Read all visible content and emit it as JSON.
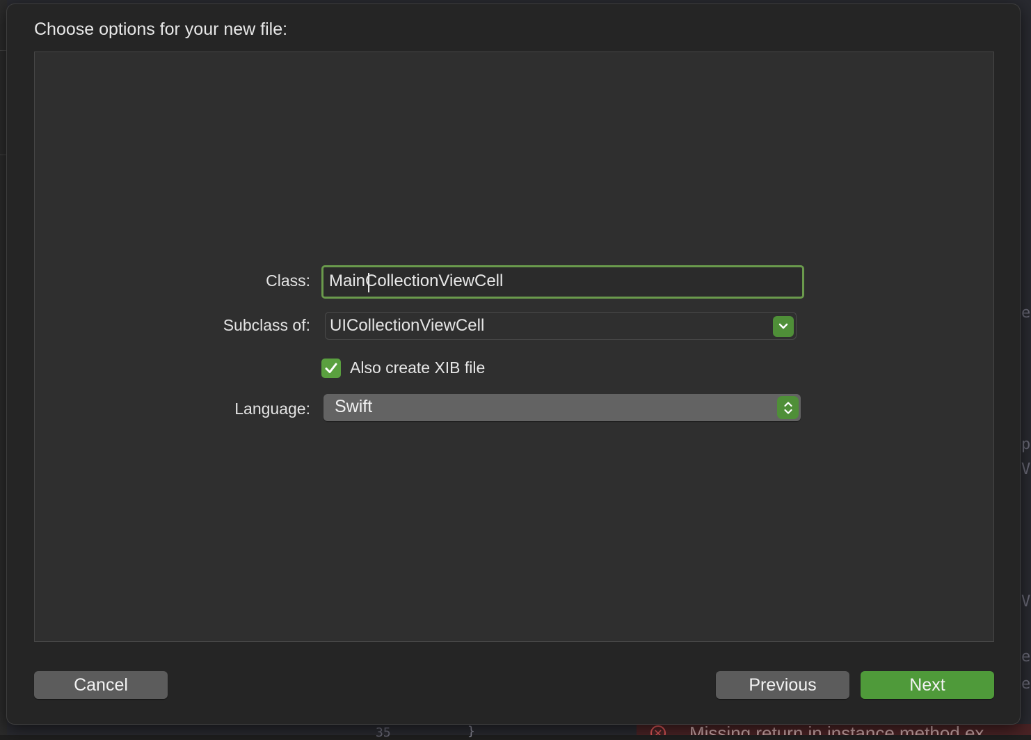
{
  "dialog": {
    "title": "Choose options for your new file:"
  },
  "form": {
    "class_label": "Class:",
    "class_value_prefix": "Main",
    "class_value_suffix": "CollectionViewCell",
    "subclass_label": "Subclass of:",
    "subclass_value": "UICollectionViewCell",
    "xib_checkbox_label": "Also create XIB file",
    "xib_checked": true,
    "language_label": "Language:",
    "language_value": "Swift"
  },
  "buttons": {
    "cancel": "Cancel",
    "previous": "Previous",
    "next": "Next"
  },
  "background": {
    "error_message": "Missing return in instance method ex",
    "line_number": "35",
    "brace": "}",
    "code_fragments": [
      "ed",
      "pl",
      "Vi",
      "Vi",
      "el",
      "e"
    ]
  },
  "colors": {
    "accent_green": "#4f9a3a",
    "focus_ring": "#6a9a4c",
    "sheet_bg": "#252525",
    "panel_bg": "#2f2f2f"
  },
  "icons": {
    "combo": "chevron-down-icon",
    "popup": "up-down-chevron-icon",
    "checkbox": "checkmark-icon",
    "error": "error-circle-icon"
  }
}
